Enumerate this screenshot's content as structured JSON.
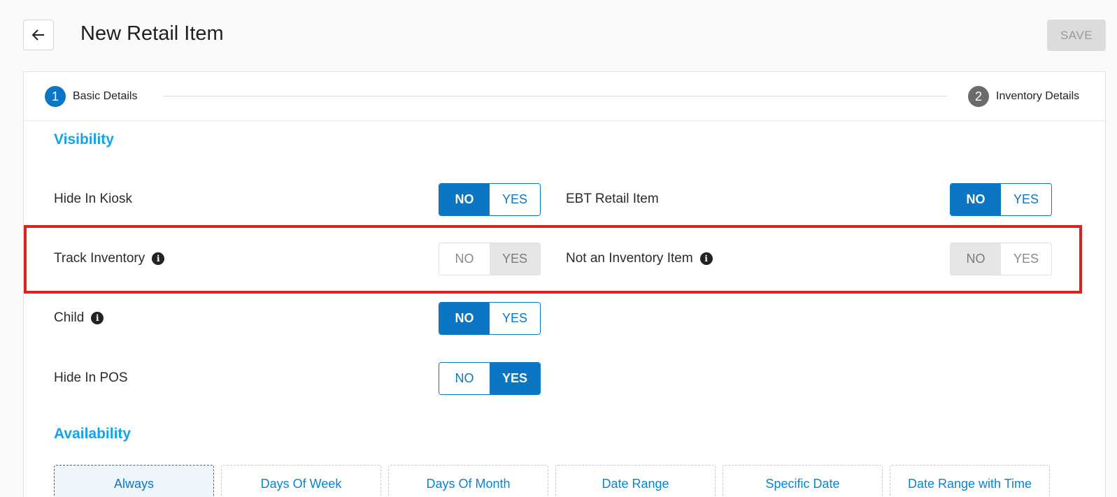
{
  "header": {
    "title": "New Retail Item",
    "save_label": "SAVE"
  },
  "stepper": {
    "steps": [
      {
        "number": "1",
        "label": "Basic Details",
        "active": true
      },
      {
        "number": "2",
        "label": "Inventory Details",
        "active": false
      }
    ]
  },
  "visibility": {
    "heading": "Visibility",
    "fields": [
      {
        "label": "Hide In Kiosk",
        "no": "NO",
        "yes": "YES",
        "selected": "NO",
        "enabled": true
      },
      {
        "label": "EBT Retail Item",
        "no": "NO",
        "yes": "YES",
        "selected": "NO",
        "enabled": true
      },
      {
        "label": "Track Inventory",
        "no": "NO",
        "yes": "YES",
        "selected": "YES",
        "enabled": false
      },
      {
        "label": "Not an Inventory Item",
        "no": "NO",
        "yes": "YES",
        "selected": "NO",
        "enabled": false
      },
      {
        "label": "Child",
        "no": "NO",
        "yes": "YES",
        "selected": "NO",
        "enabled": true
      },
      {
        "label": "Hide In POS",
        "no": "NO",
        "yes": "YES",
        "selected": "YES",
        "enabled": true
      }
    ]
  },
  "availability": {
    "heading": "Availability",
    "options": [
      "Always",
      "Days Of Week",
      "Days Of Month",
      "Date Range",
      "Specific Date",
      "Date Range with Time"
    ],
    "selected": "Always"
  },
  "icons": {
    "back": "arrow-left-icon",
    "info": "info-icon"
  },
  "colors": {
    "primary": "#0a76c4",
    "heading": "#16a2e8",
    "highlight": "#e0201f"
  }
}
